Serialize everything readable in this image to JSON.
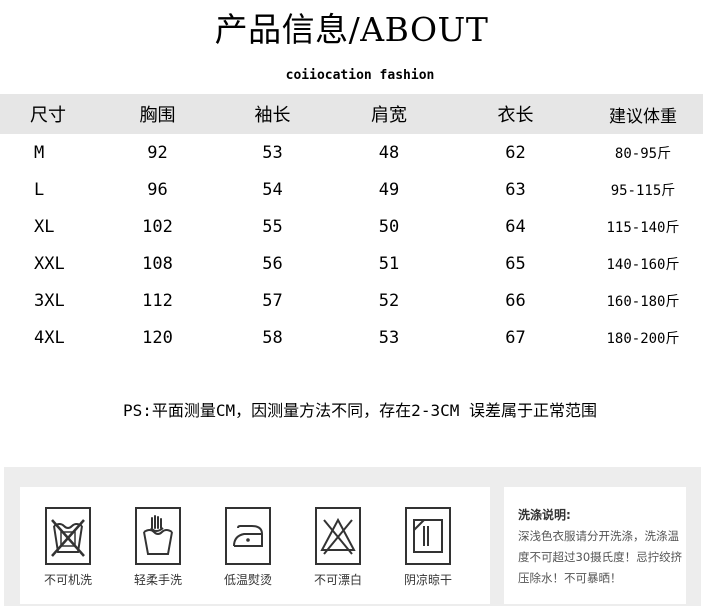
{
  "title": "产品信息/ABOUT",
  "subtitle": "coiiocation fashion",
  "table": {
    "headers": [
      "尺寸",
      "胸围",
      "袖长",
      "肩宽",
      "衣长",
      "建议体重"
    ],
    "rows": [
      [
        "M",
        "92",
        "53",
        "48",
        "62",
        "80-95斤"
      ],
      [
        "L",
        "96",
        "54",
        "49",
        "63",
        "95-115斤"
      ],
      [
        "XL",
        "102",
        "55",
        "50",
        "64",
        "115-140斤"
      ],
      [
        "XXL",
        "108",
        "56",
        "51",
        "65",
        "140-160斤"
      ],
      [
        "3XL",
        "112",
        "57",
        "52",
        "66",
        "160-180斤"
      ],
      [
        "4XL",
        "120",
        "58",
        "53",
        "67",
        "180-200斤"
      ]
    ]
  },
  "note": "PS:平面测量CM，因测量方法不同，存在2-3CM 误差属于正常范围",
  "care": {
    "items": [
      {
        "icon": "no-machine-wash-icon",
        "label": "不可机洗"
      },
      {
        "icon": "hand-wash-icon",
        "label": "轻柔手洗"
      },
      {
        "icon": "low-temp-iron-icon",
        "label": "低温熨烫"
      },
      {
        "icon": "no-bleach-icon",
        "label": "不可漂白"
      },
      {
        "icon": "shade-dry-icon",
        "label": "阴凉晾干"
      }
    ],
    "wash_title": "洗涤说明:",
    "wash_lines": [
      "深浅色衣服请分开洗涤，洗涤温",
      "度不可超过30摄氏度！忌拧绞挤",
      "压除水！不可暴晒！"
    ]
  }
}
